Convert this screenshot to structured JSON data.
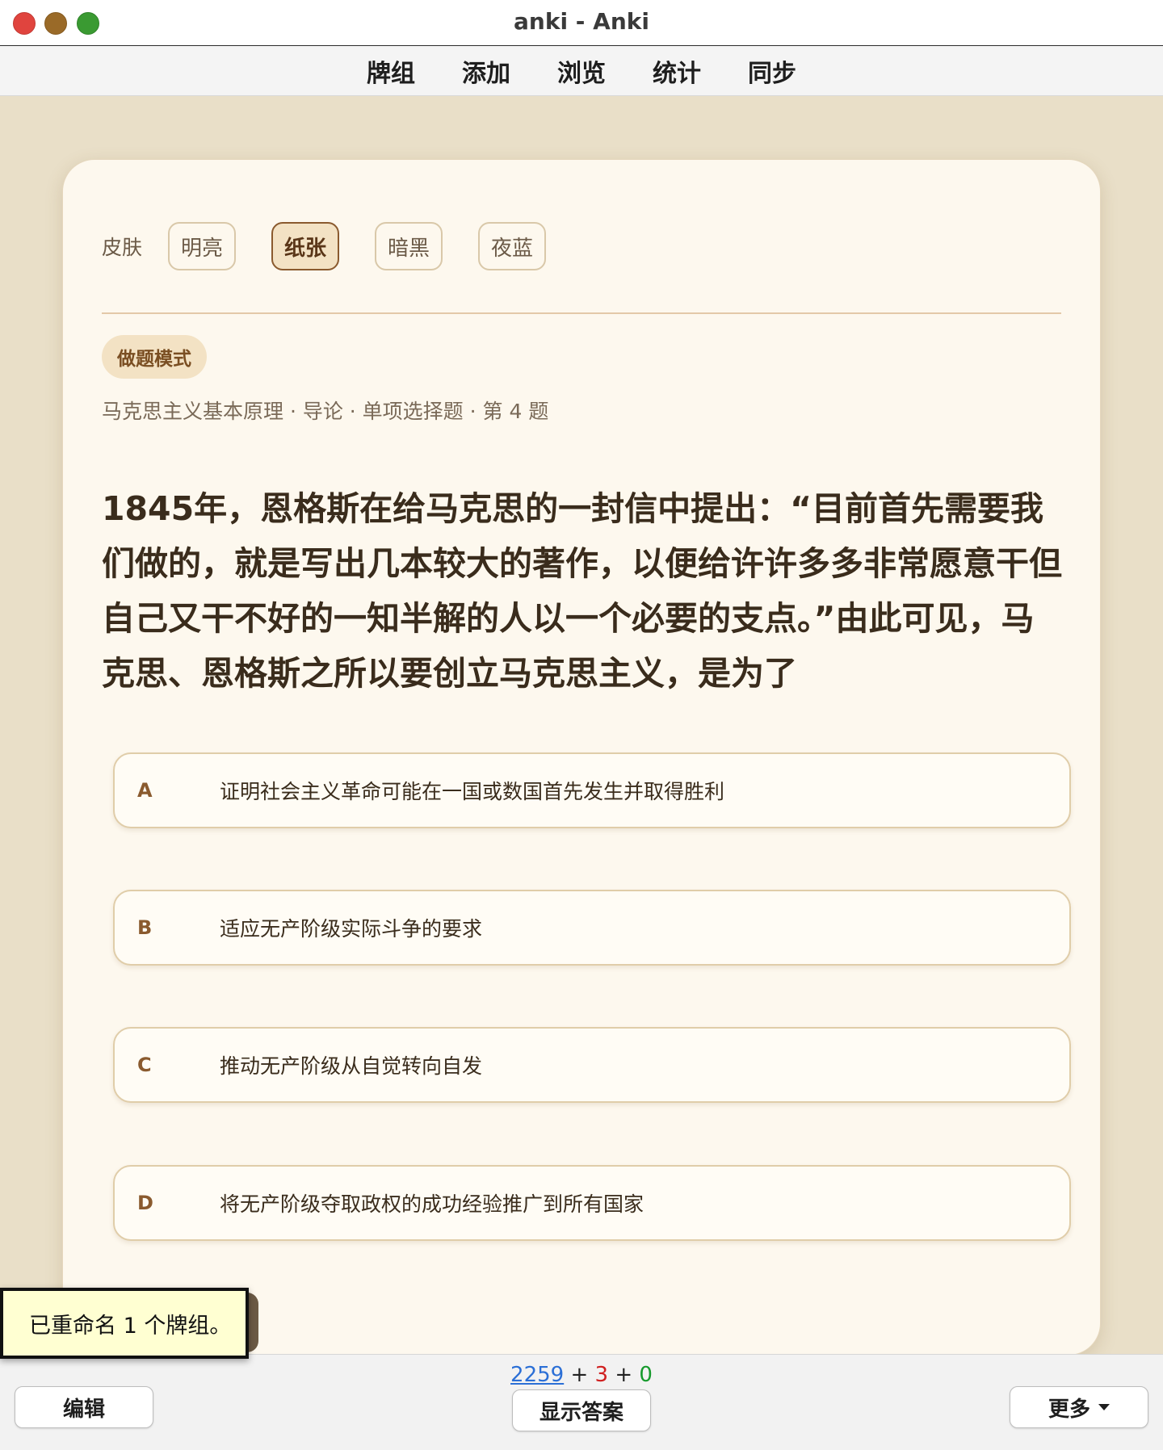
{
  "window": {
    "title": "anki - Anki"
  },
  "nav": {
    "items": [
      "牌组",
      "添加",
      "浏览",
      "统计",
      "同步"
    ]
  },
  "card": {
    "skin_label": "皮肤",
    "skins": [
      "明亮",
      "纸张",
      "暗黑",
      "夜蓝"
    ],
    "active_skin": "纸张",
    "mode": "做题模式",
    "breadcrumb": "马克思主义基本原理 · 导论 · 单项选择题 · 第 4 题",
    "question": "1845年，恩格斯在给马克思的一封信中提出：“目前首先需要我们做的，就是写出几本较大的著作，以便给许许多多非常愿意干但自己又干不好的一知半解的人以一个必要的支点。”由此可见，马克思、恩格斯之所以要创立马克思主义，是为了",
    "options": [
      {
        "letter": "A",
        "text": "证明社会主义革命可能在一国或数国首先发生并取得胜利"
      },
      {
        "letter": "B",
        "text": "适应无产阶级实际斗争的要求"
      },
      {
        "letter": "C",
        "text": "推动无产阶级从自觉转向自发"
      },
      {
        "letter": "D",
        "text": "将无产阶级夺取政权的成功经验推广到所有国家"
      }
    ]
  },
  "bottom": {
    "counts": {
      "new": "2259",
      "plus": "+",
      "learn": "3",
      "review": "0"
    },
    "edit_label": "编辑",
    "show_answer_label": "显示答案",
    "more_label": "更多"
  },
  "tooltip": {
    "text": "已重命名 1 个牌组。"
  },
  "colors": {
    "background": "#e9dfc8",
    "card": "#fdf8ee",
    "accent": "#8a5a2e",
    "new_count": "#2b6fd6",
    "learn_count": "#d02020",
    "review_count": "#169a2c"
  }
}
